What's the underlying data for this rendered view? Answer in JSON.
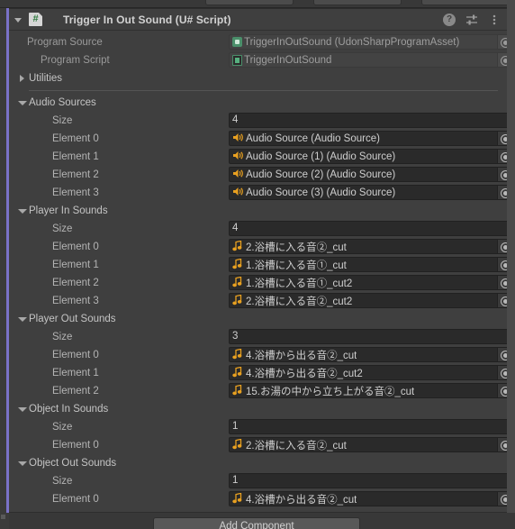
{
  "window": {
    "panel": "Inspector",
    "prefab_override_color": "#7a72c8",
    "background_color": "#3f3f3f"
  },
  "component_header": {
    "title": "Trigger In Out Sound (U# Script)",
    "script_icon": "csharp-script-icon",
    "foldout_state": "open",
    "icons": [
      {
        "name": "help-icon",
        "glyph": "?"
      },
      {
        "name": "preset-icon",
        "glyph": "sliders"
      },
      {
        "name": "more-menu-icon",
        "glyph": "kebab"
      }
    ]
  },
  "fields": {
    "program_source": {
      "label": "Program Source",
      "value": "TriggerInOutSound (UdonSharpProgramAsset)",
      "icon": "udon-program-asset-icon",
      "disabled": true
    },
    "program_script": {
      "label": "Program Script",
      "value": "TriggerInOutSound",
      "icon": "udon-script-icon",
      "disabled": true
    }
  },
  "utilities": {
    "label": "Utilities",
    "expanded": false
  },
  "arrays": [
    {
      "name": "audio-sources",
      "label": "Audio Sources",
      "expanded": true,
      "size_label": "Size",
      "size": "4",
      "element_icon": "audio-source-icon",
      "elements": [
        {
          "label": "Element 0",
          "value": "Audio Source (Audio Source)"
        },
        {
          "label": "Element 1",
          "value": "Audio Source (1) (Audio Source)"
        },
        {
          "label": "Element 2",
          "value": "Audio Source (2) (Audio Source)"
        },
        {
          "label": "Element 3",
          "value": "Audio Source (3) (Audio Source)"
        }
      ]
    },
    {
      "name": "player-in-sounds",
      "label": "Player In Sounds",
      "expanded": true,
      "size_label": "Size",
      "size": "4",
      "element_icon": "audio-clip-icon",
      "elements": [
        {
          "label": "Element 0",
          "value": "2.浴槽に入る音②_cut"
        },
        {
          "label": "Element 1",
          "value": "1.浴槽に入る音①_cut"
        },
        {
          "label": "Element 2",
          "value": "1.浴槽に入る音①_cut2"
        },
        {
          "label": "Element 3",
          "value": "2.浴槽に入る音②_cut2"
        }
      ]
    },
    {
      "name": "player-out-sounds",
      "label": "Player Out Sounds",
      "expanded": true,
      "size_label": "Size",
      "size": "3",
      "element_icon": "audio-clip-icon",
      "elements": [
        {
          "label": "Element 0",
          "value": "4.浴槽から出る音②_cut"
        },
        {
          "label": "Element 1",
          "value": "4.浴槽から出る音②_cut2"
        },
        {
          "label": "Element 2",
          "value": "15.お湯の中から立ち上がる音②_cut"
        }
      ]
    },
    {
      "name": "object-in-sounds",
      "label": "Object In Sounds",
      "expanded": true,
      "size_label": "Size",
      "size": "1",
      "element_icon": "audio-clip-icon",
      "elements": [
        {
          "label": "Element 0",
          "value": "2.浴槽に入る音②_cut"
        }
      ]
    },
    {
      "name": "object-out-sounds",
      "label": "Object Out Sounds",
      "expanded": true,
      "size_label": "Size",
      "size": "1",
      "element_icon": "audio-clip-icon",
      "elements": [
        {
          "label": "Element 0",
          "value": "4.浴槽から出る音②_cut"
        }
      ]
    }
  ],
  "footer": {
    "add_component_label": "Add Component"
  }
}
